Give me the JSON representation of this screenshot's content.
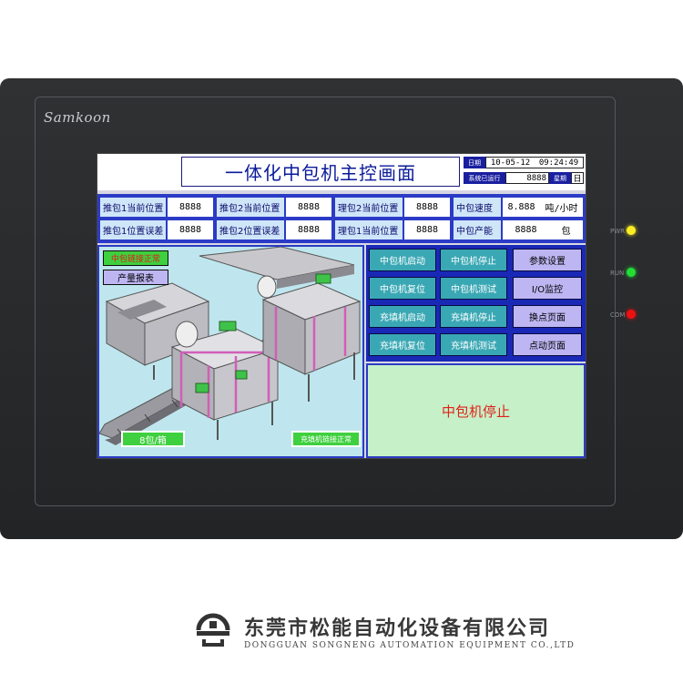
{
  "brand": "Samkoon",
  "leds": [
    {
      "label": "PWR",
      "color": "#ffee22"
    },
    {
      "label": "RUN",
      "color": "#22dd33"
    },
    {
      "label": "COM",
      "color": "#ee1111"
    }
  ],
  "header": {
    "title": "一体化中包机主控画面",
    "date_label": "日期",
    "date": "10-05-12",
    "time": "09:24:49",
    "runtime_label": "系统已运行",
    "runtime_value": "8888",
    "weekday_label": "星期",
    "weekday": "日"
  },
  "data_rows": [
    [
      {
        "label": "推包1当前位置",
        "value": "8888"
      },
      {
        "label": "推包2当前位置",
        "value": "8888"
      },
      {
        "label": "理包2当前位置",
        "value": "8888"
      },
      {
        "label": "中包速度",
        "value": "8.888",
        "unit": "吨/小时"
      }
    ],
    [
      {
        "label": "推包1位置误差",
        "value": "8888"
      },
      {
        "label": "推包2位置误差",
        "value": "8888"
      },
      {
        "label": "理包1当前位置",
        "value": "8888"
      },
      {
        "label": "中包产能",
        "value": "8888",
        "unit": "包"
      }
    ]
  ],
  "image_panel": {
    "link_status": "中包链接正常",
    "report_button": "产量报表",
    "pack_count": "8包/箱",
    "filler_link_status": "充填机链接正常"
  },
  "buttons": [
    [
      "中包机启动",
      "中包机停止",
      "参数设置"
    ],
    [
      "中包机复位",
      "中包机测试",
      "I/O监控"
    ],
    [
      "充填机启动",
      "充填机停止",
      "换点页面"
    ],
    [
      "充填机复位",
      "充填机测试",
      "点动页面"
    ]
  ],
  "status_message": "中包机停止",
  "company": {
    "name_cn": "东莞市松能自动化设备有限公司",
    "name_en": "DONGGUAN SONGNENG AUTOMATION EQUIPMENT CO.,LTD"
  }
}
